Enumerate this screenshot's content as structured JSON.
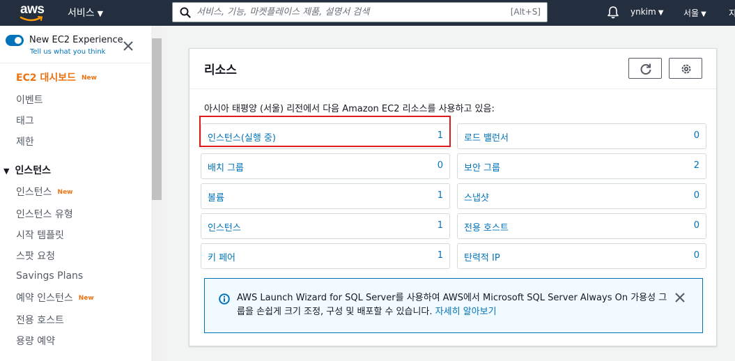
{
  "topnav": {
    "logo_text": "aws",
    "services_label": "서비스",
    "search_placeholder": "서비스, 기능, 마켓플레이스 제품, 설명서 검색",
    "search_shortcut": "[Alt+S]",
    "user_name": "ynkim",
    "region_label": "서울",
    "support_partial": "지"
  },
  "sidebar": {
    "toggle_label": "New EC2 Experience",
    "toggle_link": "Tell us what you think",
    "toggle_on": true,
    "new_badge": "New",
    "items": [
      {
        "label": "EC2 대시보드",
        "active": true,
        "new": true
      },
      {
        "label": "이벤트"
      },
      {
        "label": "태그"
      },
      {
        "label": "제한"
      }
    ],
    "section": {
      "label": "인스턴스"
    },
    "section_items": [
      {
        "label": "인스턴스",
        "new": true
      },
      {
        "label": "인스턴스 유형"
      },
      {
        "label": "시작 템플릿"
      },
      {
        "label": "스팟 요청"
      },
      {
        "label": "Savings Plans"
      },
      {
        "label": "예약 인스턴스",
        "new": true
      },
      {
        "label": "전용 호스트"
      },
      {
        "label": "용량 예약"
      }
    ]
  },
  "resources": {
    "title": "리소스",
    "description": "아시아 태평양 (서울) 리전에서 다음 Amazon EC2 리소스를 사용하고 있음:",
    "items": [
      {
        "label": "인스턴스(실행 중)",
        "count": "1"
      },
      {
        "label": "로드 밸런서",
        "count": "0"
      },
      {
        "label": "배치 그룹",
        "count": "0"
      },
      {
        "label": "보안 그룹",
        "count": "2"
      },
      {
        "label": "볼륨",
        "count": "1"
      },
      {
        "label": "스냅샷",
        "count": "0"
      },
      {
        "label": "인스턴스",
        "count": "1"
      },
      {
        "label": "전용 호스트",
        "count": "0"
      },
      {
        "label": "키 페어",
        "count": "1"
      },
      {
        "label": "탄력적 IP",
        "count": "0"
      }
    ],
    "info_text": "AWS Launch Wizard for SQL Server를 사용하여 AWS에서 Microsoft SQL Server Always On 가용성 그룹을 손쉽게 크기 조정, 구성 및 배포할 수 있습니다.",
    "info_link": "자세히 알아보기"
  },
  "colors": {
    "nav_bg": "#232f3e",
    "accent": "#ec7211",
    "link": "#0073bb",
    "highlight": "#e0191d"
  }
}
